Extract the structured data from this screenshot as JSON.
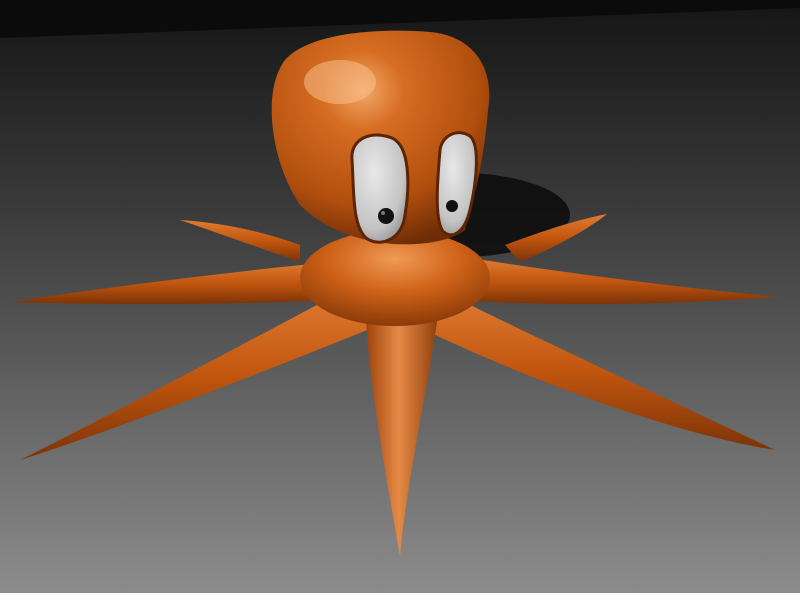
{
  "scene": {
    "subject": "cartoon-octopus",
    "colors": {
      "body": "#c55a12",
      "body_highlight": "#f0a060",
      "body_shadow": "#7a3208",
      "floor_near": "#8a8a8a",
      "floor_far": "#1a1a1a",
      "wall": "#0c0c0c",
      "eye_white": "#d8d8d8",
      "pupil": "#111111",
      "shadow": "#0a0a0a"
    },
    "tentacle_count": 8
  }
}
